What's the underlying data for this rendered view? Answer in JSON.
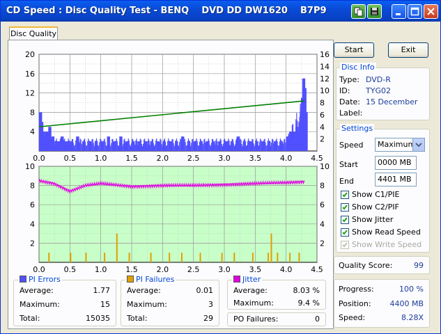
{
  "window": {
    "title": "CD Speed : Disc Quality Test - BENQ    DVD DD DW1620    B7P9"
  },
  "tab": {
    "label": "Disc Quality"
  },
  "buttons": {
    "start": "Start",
    "exit": "Exit"
  },
  "disc_info": {
    "title": "Disc Info",
    "type_label": "Type:",
    "type_value": "DVD-R",
    "id_label": "ID:",
    "id_value": "TYG02",
    "date_label": "Date:",
    "date_value": "15 December",
    "label_label": "Label:",
    "label_value": ""
  },
  "settings": {
    "title": "Settings",
    "speed_label": "Speed",
    "speed_value": "Maximum",
    "start_label": "Start",
    "start_value": "0000 MB",
    "end_label": "End",
    "end_value": "4401 MB",
    "show_c1pie": "Show C1/PIE",
    "show_c2pif": "Show C2/PIF",
    "show_jitter": "Show Jitter",
    "show_read_speed": "Show Read Speed",
    "show_write_speed": "Show Write Speed"
  },
  "quality": {
    "label": "Quality Score:",
    "value": "99"
  },
  "progress": {
    "progress_label": "Progress:",
    "progress_value": "100 %",
    "position_label": "Position:",
    "position_value": "4400 MB",
    "speed_label": "Speed:",
    "speed_value": "8.28X"
  },
  "pi_errors": {
    "title": "PI Errors",
    "avg_label": "Average:",
    "avg": "1.77",
    "max_label": "Maximum:",
    "max": "15",
    "total_label": "Total:",
    "total": "15035"
  },
  "pi_failures": {
    "title": "PI Failures",
    "avg_label": "Average:",
    "avg": "0.01",
    "max_label": "Maximum:",
    "max": "3",
    "total_label": "Total:",
    "total": "29"
  },
  "jitter": {
    "title": "Jitter",
    "avg_label": "Average:",
    "avg": "8.03 %",
    "max_label": "Maximum:",
    "max": "9.4 %",
    "po_label": "PO Failures:",
    "po": "0"
  },
  "colors": {
    "pi_errors": "#5050ff",
    "pi_failures": "#e0a000",
    "jitter": "#e000e0",
    "read_speed": "#008000",
    "lower_bg": "#c8ffc8"
  },
  "chart_data": [
    {
      "type": "bar",
      "name": "upper",
      "x_ticks": [
        "0.0",
        "0.5",
        "1.0",
        "1.5",
        "2.0",
        "2.5",
        "3.0",
        "3.5",
        "4.0",
        "4.5"
      ],
      "y_left_ticks": [
        "20",
        "16",
        "12",
        "8",
        "4"
      ],
      "y_right_ticks": [
        "16",
        "14",
        "12",
        "10",
        "8",
        "6",
        "4",
        "2"
      ],
      "xlim": [
        0,
        4.5
      ],
      "ylim_left": [
        0,
        20
      ],
      "ylim_right": [
        0,
        16
      ],
      "series": [
        {
          "type": "bar",
          "x": [
            0.0,
            0.02,
            0.05,
            0.08,
            0.1,
            0.12,
            0.15,
            0.2,
            0.25,
            0.3,
            0.35,
            0.4,
            0.45,
            0.5,
            0.6,
            0.7,
            0.8,
            0.9,
            1.0,
            1.1,
            1.2,
            1.3,
            1.4,
            1.5,
            1.6,
            1.7,
            1.8,
            1.9,
            2.0,
            2.1,
            2.2,
            2.3,
            2.4,
            2.5,
            2.6,
            2.7,
            2.8,
            2.9,
            3.0,
            3.1,
            3.2,
            3.3,
            3.4,
            3.5,
            3.6,
            3.7,
            3.8,
            3.9,
            4.0,
            4.05,
            4.1,
            4.15,
            4.2,
            4.22,
            4.24,
            4.26,
            4.28,
            4.3
          ],
          "values": [
            8,
            6,
            4,
            3,
            4,
            3,
            5,
            3,
            2,
            2,
            3,
            2,
            2,
            2,
            3,
            2,
            2,
            2,
            2,
            3,
            2,
            3,
            2,
            2,
            2,
            2,
            2,
            2,
            2,
            2,
            2,
            3,
            2,
            2,
            2,
            2,
            2,
            2,
            2,
            2,
            3,
            2,
            2,
            2,
            2,
            2,
            2,
            2,
            3,
            4,
            4,
            5,
            6,
            8,
            11,
            15,
            13,
            8
          ]
        },
        {
          "type": "line",
          "x": [
            0.0,
            4.3
          ],
          "values": [
            4.0,
            8.3
          ]
        }
      ]
    },
    {
      "type": "bar",
      "name": "lower",
      "x_ticks": [
        "0.0",
        "0.5",
        "1.0",
        "1.5",
        "2.0",
        "2.5",
        "3.0",
        "3.5",
        "4.0",
        "4.5"
      ],
      "y_left_ticks": [
        "10",
        "8",
        "6",
        "4",
        "2"
      ],
      "y_right_ticks": [
        "10",
        "8",
        "6",
        "4",
        "2"
      ],
      "xlim": [
        0,
        4.5
      ],
      "ylim": [
        0,
        10
      ],
      "series": [
        {
          "type": "bar",
          "x": [
            0.15,
            0.5,
            0.75,
            1.05,
            1.25,
            1.45,
            1.8,
            2.1,
            2.3,
            2.6,
            2.95,
            3.15,
            3.45,
            3.7,
            3.75,
            3.85,
            4.05,
            4.2
          ],
          "values": [
            1,
            1,
            1,
            1,
            3,
            1,
            1,
            1,
            1,
            1,
            1,
            1,
            1,
            1,
            3,
            1,
            1,
            1
          ]
        },
        {
          "type": "line",
          "x": [
            0.0,
            0.25,
            0.5,
            0.75,
            1.0,
            1.5,
            2.0,
            2.5,
            3.0,
            3.5,
            4.0,
            4.3
          ],
          "values": [
            8.5,
            8.2,
            7.4,
            8.0,
            8.2,
            7.9,
            8.0,
            8.0,
            8.1,
            8.2,
            8.3,
            8.4
          ]
        }
      ]
    }
  ]
}
